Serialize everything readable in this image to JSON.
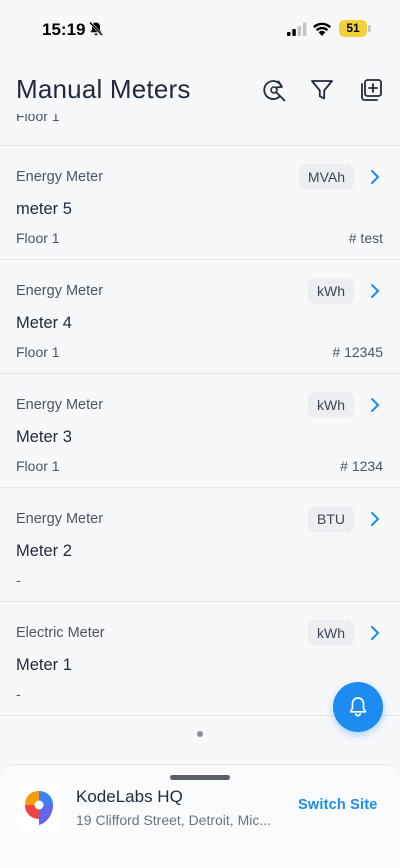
{
  "status_bar": {
    "time": "15:19",
    "battery": "51"
  },
  "header": {
    "title": "Manual Meters",
    "icons": [
      "refresh-search-icon",
      "filter-icon",
      "add-icon"
    ]
  },
  "list": {
    "partial_location": "Floor 1",
    "items": [
      {
        "type": "Energy Meter",
        "unit": "MVAh",
        "name": "meter 5",
        "location": "Floor 1",
        "tag": "# test"
      },
      {
        "type": "Energy Meter",
        "unit": "kWh",
        "name": "Meter 4",
        "location": "Floor 1",
        "tag": "# 12345"
      },
      {
        "type": "Energy Meter",
        "unit": "kWh",
        "name": "Meter 3",
        "location": "Floor 1",
        "tag": "# 1234"
      },
      {
        "type": "Energy Meter",
        "unit": "BTU",
        "name": "Meter 2",
        "location": "-",
        "tag": ""
      },
      {
        "type": "Electric Meter",
        "unit": "kWh",
        "name": "Meter 1",
        "location": "-",
        "tag": ""
      }
    ]
  },
  "site": {
    "name": "KodeLabs HQ",
    "address": "19 Clifford Street, Detroit, Mic...",
    "switch_label": "Switch Site"
  },
  "colors": {
    "accent": "#1d8bf0",
    "badge_bg": "#eceef1",
    "background": "#f7f8fa"
  }
}
